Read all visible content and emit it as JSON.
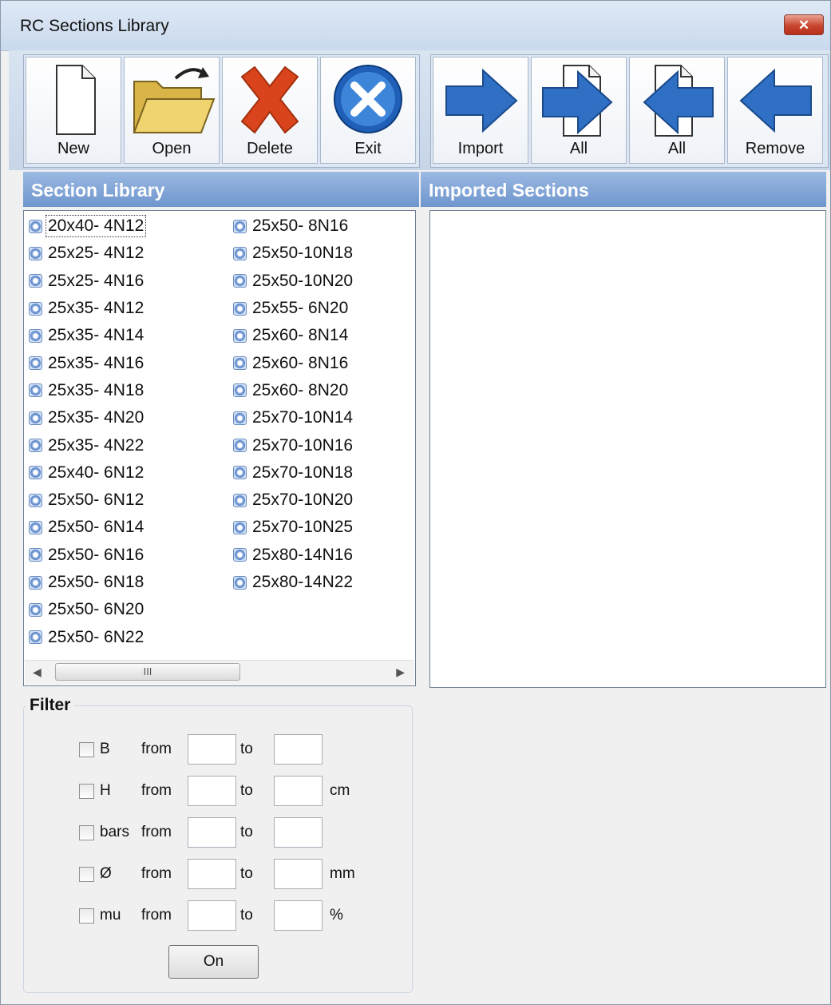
{
  "window": {
    "title": "RC Sections Library",
    "close_glyph": "✕"
  },
  "toolbar": {
    "left": [
      {
        "label": "New",
        "icon": "new-document-icon"
      },
      {
        "label": "Open",
        "icon": "open-folder-icon"
      },
      {
        "label": "Delete",
        "icon": "delete-x-icon"
      },
      {
        "label": "Exit",
        "icon": "exit-icon"
      }
    ],
    "right": [
      {
        "label": "Import",
        "icon": "arrow-right-icon"
      },
      {
        "label": "All",
        "icon": "import-all-icon"
      },
      {
        "label": "All",
        "icon": "remove-all-icon"
      },
      {
        "label": "Remove",
        "icon": "arrow-left-icon"
      }
    ]
  },
  "library": {
    "header": "Section Library",
    "selected": "20x40- 4N12",
    "col1": [
      "20x40- 4N12",
      "25x25- 4N12",
      "25x25- 4N16",
      "25x35- 4N12",
      "25x35- 4N14",
      "25x35- 4N16",
      "25x35- 4N18",
      "25x35- 4N20",
      "25x35- 4N22",
      "25x40- 6N12",
      "25x50- 6N12",
      "25x50- 6N14",
      "25x50- 6N16",
      "25x50- 6N18",
      "25x50- 6N20",
      "25x50- 6N22"
    ],
    "col2": [
      "25x50- 8N16",
      "25x50-10N18",
      "25x50-10N20",
      "25x55- 6N20",
      "25x60- 8N14",
      "25x60- 8N16",
      "25x60- 8N20",
      "25x70-10N14",
      "25x70-10N16",
      "25x70-10N18",
      "25x70-10N20",
      "25x70-10N25",
      "25x80-14N16",
      "25x80-14N22"
    ],
    "scroll_thumb_glyph": "III"
  },
  "imported": {
    "header": "Imported Sections",
    "items": []
  },
  "filter": {
    "title": "Filter",
    "rows": [
      {
        "name": "B",
        "from": "from",
        "to": "to",
        "unit": "",
        "from_value": "",
        "to_value": ""
      },
      {
        "name": "H",
        "from": "from",
        "to": "to",
        "unit": "cm",
        "from_value": "",
        "to_value": ""
      },
      {
        "name": "bars",
        "from": "from",
        "to": "to",
        "unit": "",
        "from_value": "",
        "to_value": ""
      },
      {
        "name": "Ø",
        "from": "from",
        "to": "to",
        "unit": "mm",
        "from_value": "",
        "to_value": ""
      },
      {
        "name": "mu",
        "from": "from",
        "to": "to",
        "unit": "%",
        "from_value": "",
        "to_value": ""
      }
    ],
    "on_label": "On"
  },
  "colors": {
    "header_blue": "#7a9fd4",
    "arrow_blue": "#2f6fc4",
    "delete_red": "#d9441c",
    "folder_yellow": "#e8c85a"
  }
}
